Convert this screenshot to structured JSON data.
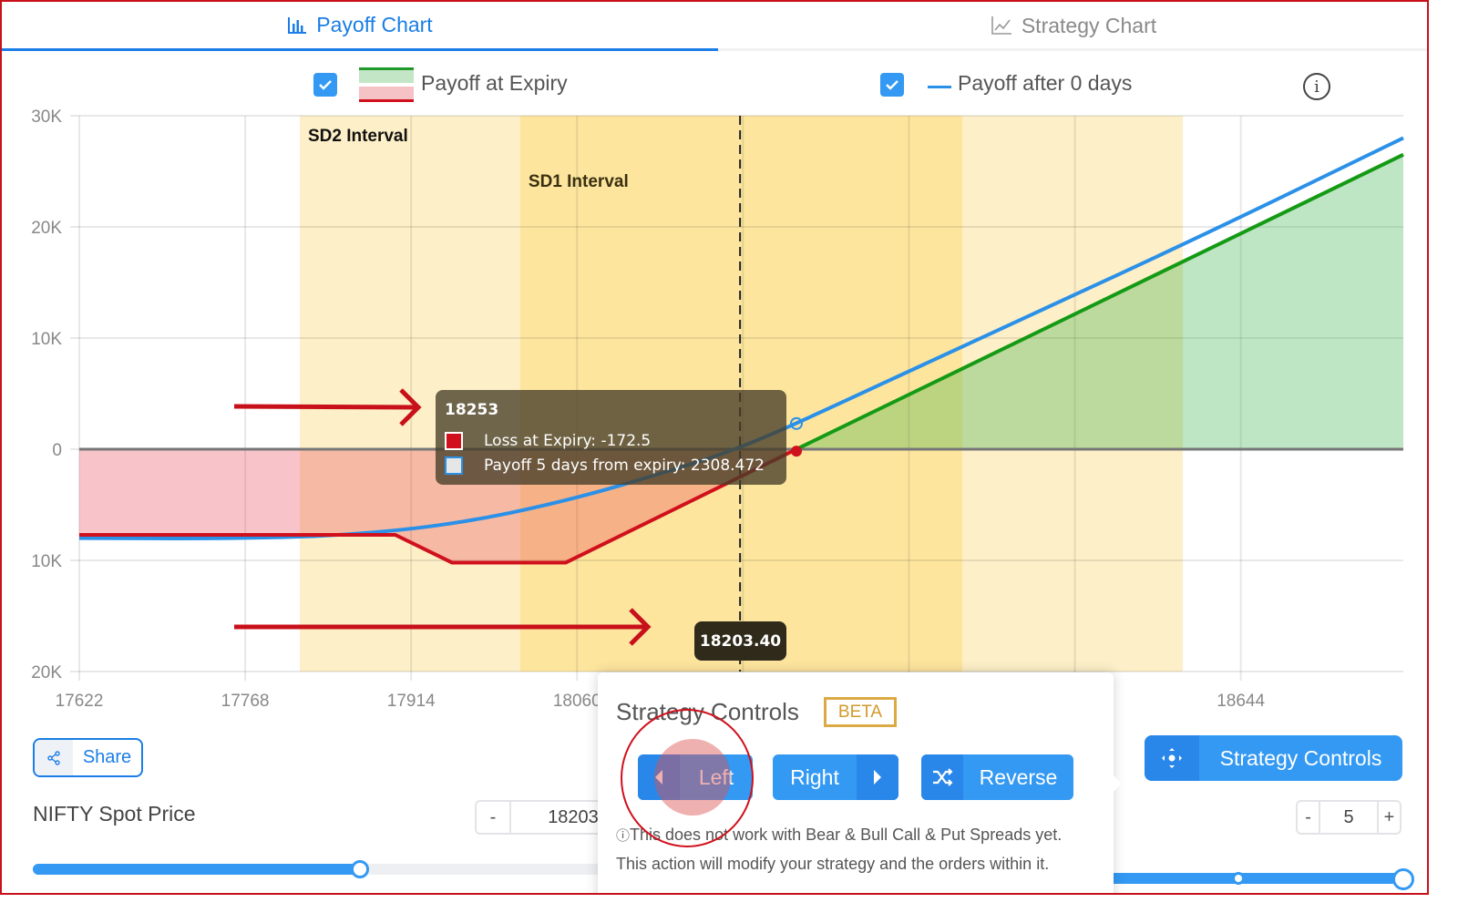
{
  "tabs": [
    {
      "label": "Payoff Chart",
      "icon": "bar-chart-icon",
      "active": true
    },
    {
      "label": "Strategy Chart",
      "icon": "line-chart-icon",
      "active": false
    }
  ],
  "legend": {
    "expiry": {
      "label": "Payoff at Expiry",
      "checked": true
    },
    "after_days": {
      "label": "Payoff after 0 days",
      "checked": true
    },
    "info_icon": "info-icon"
  },
  "tooltip": {
    "title": "18253",
    "rows": [
      {
        "label": "Loss at Expiry: -172.5",
        "color": "#d0101c"
      },
      {
        "label": "Payoff 5 days from expiry: 2308.472",
        "color": "#e6e6e6"
      }
    ]
  },
  "crosshair_label": "18203.40",
  "chart_data": {
    "type": "line",
    "title": "",
    "xlabel": "",
    "ylabel": "",
    "x_ticks": [
      17622,
      17768,
      17914,
      18060,
      18206,
      18352,
      18498,
      18644
    ],
    "x_tick_labels": [
      "17622",
      "17768",
      "17914",
      "18060",
      "",
      "",
      "",
      "18644"
    ],
    "y_ticks": [
      30000,
      20000,
      10000,
      0,
      -10000,
      -20000
    ],
    "y_tick_labels": [
      "30K",
      "20K",
      "10K",
      "0",
      "10K",
      "20K"
    ],
    "xlim": [
      17622,
      18787
    ],
    "ylim": [
      -20000,
      30000
    ],
    "grid": true,
    "bands": [
      {
        "name": "SD2 Interval",
        "from": 17816,
        "to": 18593,
        "color": "#fdefc7"
      },
      {
        "name": "SD1 Interval",
        "from": 18010,
        "to": 18399,
        "color": "#fde59e"
      }
    ],
    "current_spot": 18203.4,
    "series": [
      {
        "name": "Payoff at Expiry",
        "color_loss": "#d0101c",
        "color_profit": "#149a14",
        "fill_loss": "#f5c2c6",
        "fill_profit": "#c3e6c6",
        "x": [
          17622,
          17900,
          17950,
          18050,
          18253,
          18787
        ],
        "y": [
          -7700,
          -7700,
          -10200,
          -10200,
          0,
          26500
        ]
      },
      {
        "name": "Payoff after 0 days",
        "color": "#2a90e8",
        "x": [
          17622,
          17750,
          17850,
          17950,
          18050,
          18150,
          18200,
          18253,
          18400,
          18600,
          18787
        ],
        "y": [
          -8000,
          -8050,
          -7800,
          -6800,
          -4700,
          -1700,
          0,
          2300,
          9300,
          18700,
          28000
        ]
      }
    ],
    "markers": [
      {
        "series": "Payoff after 0 days",
        "x": 18253,
        "y": 2308.472
      },
      {
        "series": "Payoff at Expiry",
        "x": 18253,
        "y": -172.5
      }
    ]
  },
  "share": {
    "label": "Share"
  },
  "spot": {
    "label": "NIFTY Spot Price",
    "minus": "-",
    "value": "18203",
    "slider_fraction": 0.5
  },
  "strategy_controls_button": {
    "label": "Strategy Controls"
  },
  "days": {
    "minus": "-",
    "value": "5",
    "plus": "+",
    "slider_fraction": 1.0
  },
  "popover": {
    "title": "Strategy Controls",
    "badge": "BETA",
    "buttons": [
      {
        "label": "Left",
        "icon": "caret-left-icon"
      },
      {
        "label": "Right",
        "icon": "caret-right-icon"
      },
      {
        "label": "Reverse",
        "icon": "shuffle-icon"
      }
    ],
    "note_line1": "This does not work with Bear & Bull Call & Put Spreads yet.",
    "note_line2": "This action will modify your strategy and the orders within it."
  }
}
